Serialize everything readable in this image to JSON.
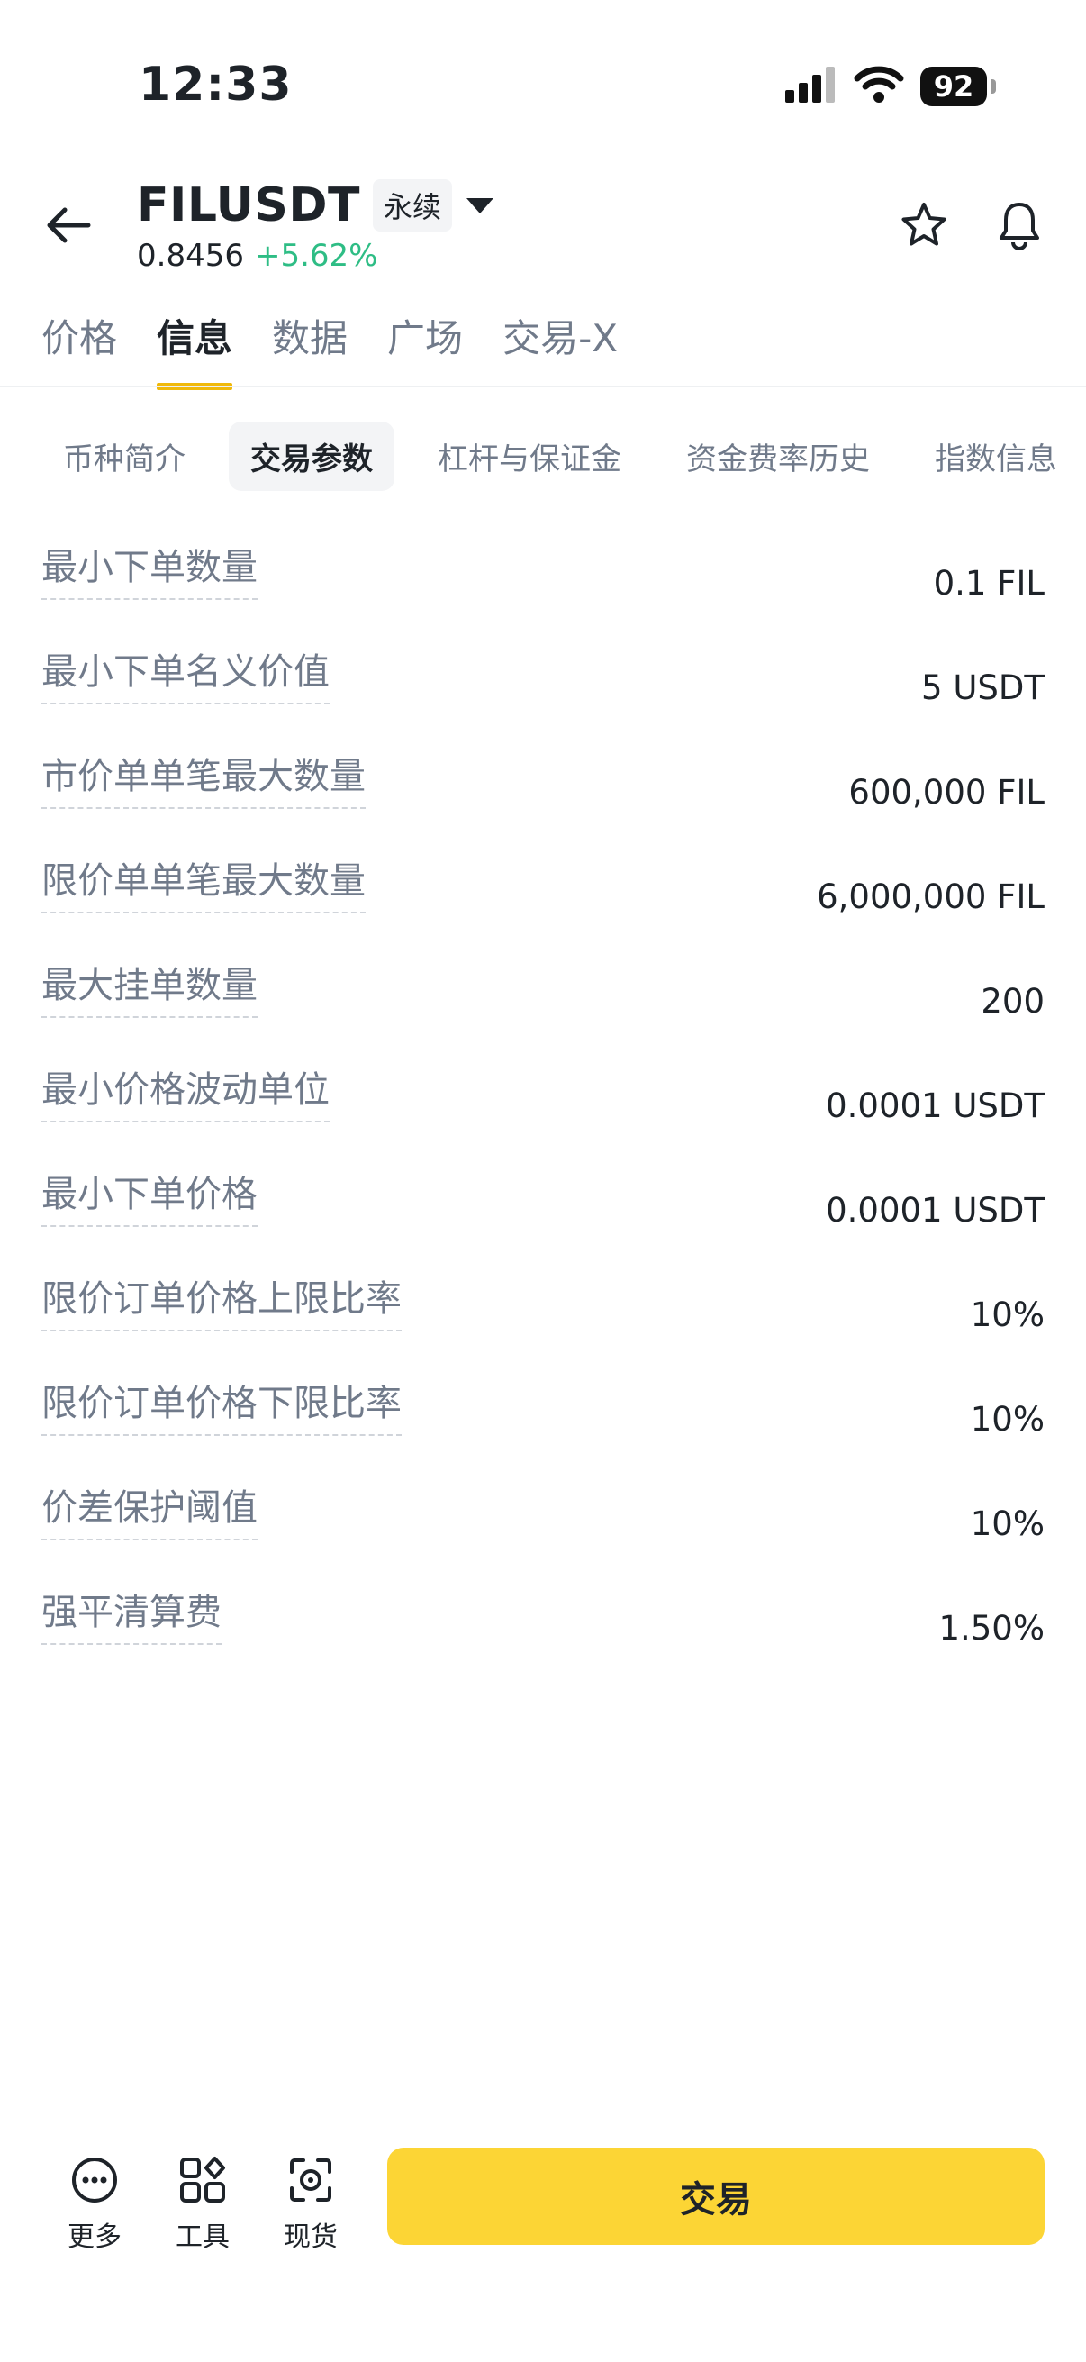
{
  "status": {
    "time": "12:33",
    "battery": "92"
  },
  "header": {
    "symbol": "FILUSDT",
    "contract_type": "永续",
    "price": "0.8456",
    "change": "+5.62%"
  },
  "main_tabs": [
    {
      "label": "价格"
    },
    {
      "label": "信息"
    },
    {
      "label": "数据"
    },
    {
      "label": "广场"
    },
    {
      "label": "交易-X"
    }
  ],
  "sub_tabs": [
    {
      "label": "币种简介"
    },
    {
      "label": "交易参数"
    },
    {
      "label": "杠杆与保证金"
    },
    {
      "label": "资金费率历史"
    },
    {
      "label": "指数信息"
    }
  ],
  "params": [
    {
      "label": "最小下单数量",
      "value": "0.1 FIL"
    },
    {
      "label": "最小下单名义价值",
      "value": "5 USDT"
    },
    {
      "label": "市价单单笔最大数量",
      "value": "600,000 FIL"
    },
    {
      "label": "限价单单笔最大数量",
      "value": "6,000,000 FIL"
    },
    {
      "label": "最大挂单数量",
      "value": "200"
    },
    {
      "label": "最小价格波动单位",
      "value": "0.0001 USDT"
    },
    {
      "label": "最小下单价格",
      "value": "0.0001 USDT"
    },
    {
      "label": "限价订单价格上限比率",
      "value": "10%"
    },
    {
      "label": "限价订单价格下限比率",
      "value": "10%"
    },
    {
      "label": "价差保护阈值",
      "value": "10%"
    },
    {
      "label": "强平清算费",
      "value": "1.50%"
    }
  ],
  "bottom_bar": {
    "more_label": "更多",
    "tools_label": "工具",
    "spot_label": "现货",
    "trade_label": "交易"
  },
  "colors": {
    "accent": "#fcd535",
    "tab_indicator": "#f0b90b",
    "positive": "#2ebd85"
  },
  "icons": [
    "signal-icon",
    "wifi-icon",
    "battery-icon",
    "back-arrow-icon",
    "dropdown-caret-icon",
    "star-icon",
    "bell-icon",
    "more-icon",
    "tools-icon",
    "spot-icon"
  ]
}
